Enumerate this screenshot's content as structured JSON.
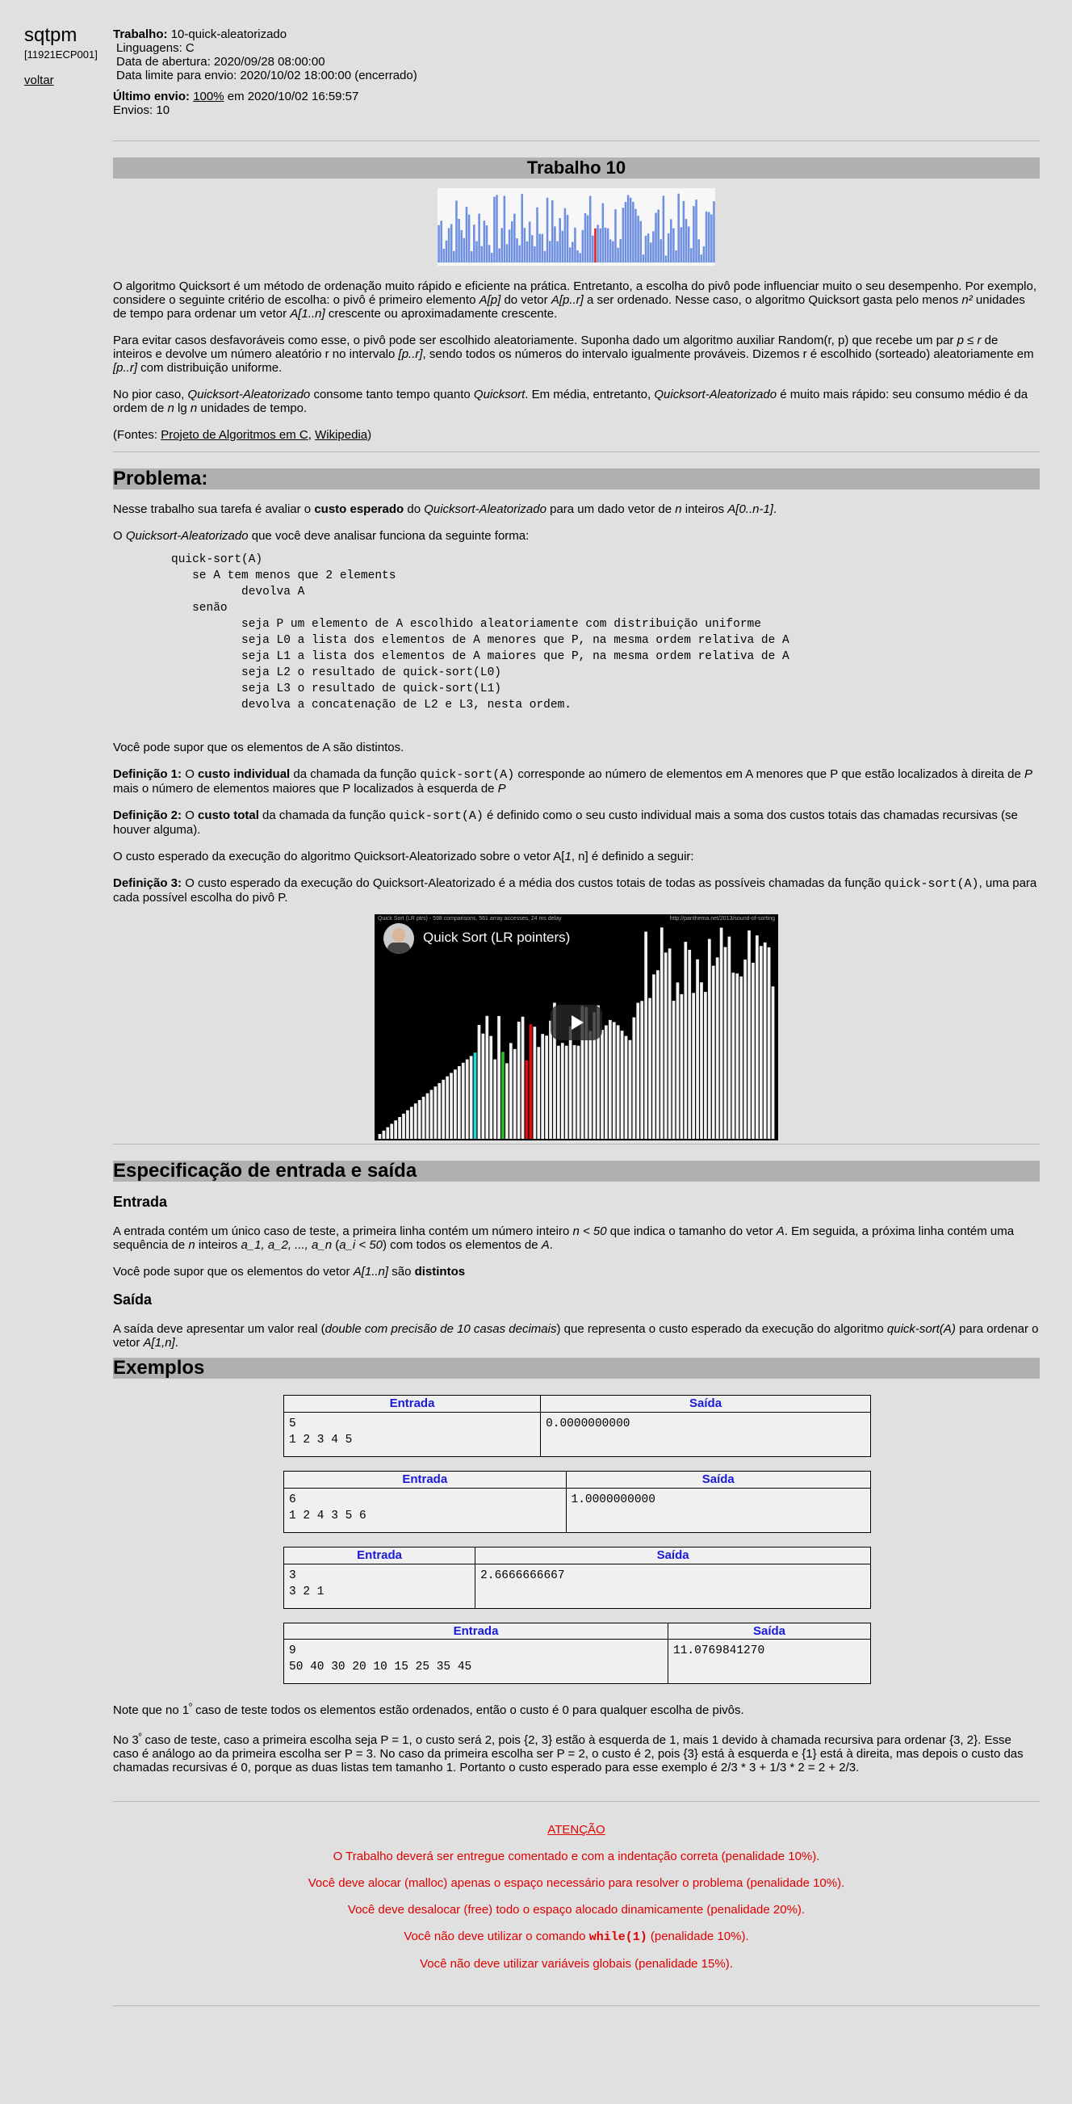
{
  "sidebar": {
    "logo": "sqtpm",
    "code": "[11921ECP001]",
    "back": "voltar"
  },
  "header": {
    "job_label": "Trabalho:",
    "job_value": "10-quick-aleatorizado",
    "lang": "Linguagens: C",
    "open": "Data de abertura: 2020/09/28 08:00:00",
    "deadline": "Data limite para envio: 2020/10/02 18:00:00 (encerrado)",
    "last_label": "Último envio:",
    "last_pct": "100%",
    "last_rest": " em 2020/10/02 16:59:57",
    "sends": "Envios: 10"
  },
  "title": "Trabalho 10",
  "intro": {
    "p1": [
      "O algoritmo Quicksort é um método de ordenação muito rápido e eficiente na prática. Entretanto, a escolha do pivô pode influenciar muito o seu desempenho. Por exemplo, considere o seguinte critério de escolha: o pivô é primeiro elemento ",
      "A[p]",
      " do vetor ",
      "A[p..r]",
      " a ser ordenado. Nesse caso, o algoritmo Quicksort gasta pelo menos ",
      "n²",
      " unidades de tempo para ordenar um vetor ",
      "A[1..n]",
      " crescente ou aproximadamente crescente."
    ],
    "p2": [
      "Para evitar casos desfavoráveis como esse, o pivô pode ser escolhido aleatoriamente. Suponha dado um algoritmo auxiliar Random(r, p) que recebe um par ",
      "p ≤ r",
      " de inteiros e devolve um número aleatório r no intervalo ",
      "[p..r]",
      ", sendo todos os números do intervalo igualmente prováveis. Dizemos r é escolhido (sorteado) aleatoriamente em ",
      "[p..r]",
      " com distribuição uniforme."
    ],
    "p3": [
      "No pior caso, ",
      "Quicksort-Aleatorizado",
      " consome tanto tempo quanto ",
      "Quicksort",
      ".  Em média, entretanto, ",
      "Quicksort-Aleatorizado",
      " é muito mais rápido:  seu consumo médio é da ordem de ",
      "n",
      " lg ",
      "n",
      " unidades de tempo."
    ],
    "sources_pre": "(Fontes: ",
    "src1": "Projeto de Algoritmos em C",
    "src_sep": ", ",
    "src2": "Wikipedia",
    "sources_post": ")"
  },
  "problem": {
    "heading": "Problema:",
    "p1": [
      "Nesse trabalho sua tarefa é avaliar o ",
      "custo esperado",
      " do ",
      "Quicksort-Aleatorizado",
      " para um dado vetor de ",
      "n",
      " inteiros ",
      "A[0..n-1]",
      "."
    ],
    "p2": [
      "O ",
      "Quicksort-Aleatorizado",
      " que você deve analisar funciona da seguinte forma:"
    ],
    "code": "quick-sort(A)\n   se A tem menos que 2 elements\n          devolva A\n   senão\n          seja P um elemento de A escolhido aleatoriamente com distribuição uniforme\n          seja L0 a lista dos elementos de A menores que P, na mesma ordem relativa de A\n          seja L1 a lista dos elementos de A maiores que P, na mesma ordem relativa de A\n          seja L2 o resultado de quick-sort(L0)\n          seja L3 o resultado de quick-sort(L1)\n          devolva a concatenação de L2 e L3, nesta ordem.",
    "p3": "Você pode supor que os elementos de A são distintos.",
    "def1": [
      "Definição 1:",
      " O ",
      "custo individual",
      " da chamada da função ",
      "quick-sort(A)",
      " corresponde ao número de elementos em A menores que P que estão localizados à direita de ",
      "P",
      " mais o número de elementos maiores que P localizados à esquerda de ",
      "P"
    ],
    "def2": [
      "Definição 2:",
      " O ",
      "custo total",
      " da chamada da função ",
      "quick-sort(A)",
      " é definido como o seu custo individual mais a soma dos custos totais das chamadas recursivas (se houver alguma)."
    ],
    "p4": [
      "O custo esperado da execução do algoritmo Quicksort-Aleatorizado sobre o vetor A[",
      "1",
      ", n] é definido a seguir:"
    ],
    "def3": [
      "Definição 3:",
      " O custo esperado da execução do Quicksort-Aleatorizado é a média dos custos totais de todas as possíveis chamadas da função ",
      "quick-sort(A)",
      ", uma para cada possível escolha do pivô P."
    ]
  },
  "video": {
    "title": "Quick Sort (LR pointers)",
    "caption_left": "Quick Sort (LR ptrs) - 598 comparisons, 561 array accesses, 24 ms delay",
    "caption_right": "http://panthema.net/2013/sound-of-sorting"
  },
  "spec": {
    "heading": "Especificação de entrada e saída",
    "in_title": "Entrada",
    "in_p1": [
      "A entrada contém um único caso de teste, a primeira linha contém um número inteiro ",
      "n < 50",
      " que indica o tamanho do vetor ",
      "A",
      ". Em seguida, a próxima linha contém uma sequência de ",
      "n",
      " inteiros ",
      "a_1, a_2, ..., a_n",
      " (",
      "a_i < 50",
      ") com todos os elementos de ",
      "A",
      "."
    ],
    "in_p2": [
      "Você pode supor que os elementos do vetor ",
      "A[1..n]",
      " são ",
      "distintos"
    ],
    "out_title": "Saída",
    "out_p": [
      "A saída deve apresentar um valor real (",
      "double com precisão de 10 casas decimais",
      ") que representa o custo esperado da execução do algoritmo ",
      "quick-sort(A)",
      " para ordenar o vetor ",
      "A[1,n]",
      "."
    ]
  },
  "examples": {
    "heading": "Exemplos",
    "col_in": "Entrada",
    "col_out": "Saída",
    "rows": [
      {
        "in": "5\n1 2 3 4 5",
        "out": "0.0000000000"
      },
      {
        "in": "6\n1 2 4 3 5 6",
        "out": "1.0000000000"
      },
      {
        "in": "3\n3 2 1",
        "out": "2.6666666667"
      },
      {
        "in": "9\n50 40 30 20 10 15 25 35 45",
        "out": "11.0769841270"
      }
    ],
    "note1": [
      "Note que no 1",
      "º",
      " caso de teste todos os elementos estão ordenados, então o custo é 0 para qualquer escolha de pivôs."
    ],
    "note2": [
      "No 3",
      "º",
      " caso de teste, caso a primeira escolha seja P = 1, o custo será 2, pois {2, 3} estão à esquerda de 1, mais 1 devido à chamada recursiva para ordenar {3, 2}. Esse caso é análogo ao da primeira escolha ser P = 3. No caso da primeira escolha ser P = 2, o custo é 2, pois {3} está à esquerda e {1} está à direita, mas depois o custo das chamadas recursivas é 0, porque as duas listas tem tamanho 1. Portanto o custo esperado para esse exemplo é 2/3 * 3 + 1/3 * 2 = 2 + 2/3."
    ]
  },
  "warnings": {
    "title": "ATENÇÃO",
    "w1": "O Trabalho deverá ser entregue comentado e com a indentação correta (penalidade 10%).",
    "w2": "Você deve alocar (malloc) apenas o espaço necessário para resolver o problema (penalidade 10%).",
    "w3": "Você deve desalocar (free) todo o espaço alocado dinamicamente (penalidade 20%).",
    "w4_pre": "Você não deve utilizar o comando ",
    "w4_code": "while(1)",
    "w4_post": " (penalidade 10%).",
    "w5": "Você não deve utilizar variáveis globais (penalidade 15%)."
  }
}
